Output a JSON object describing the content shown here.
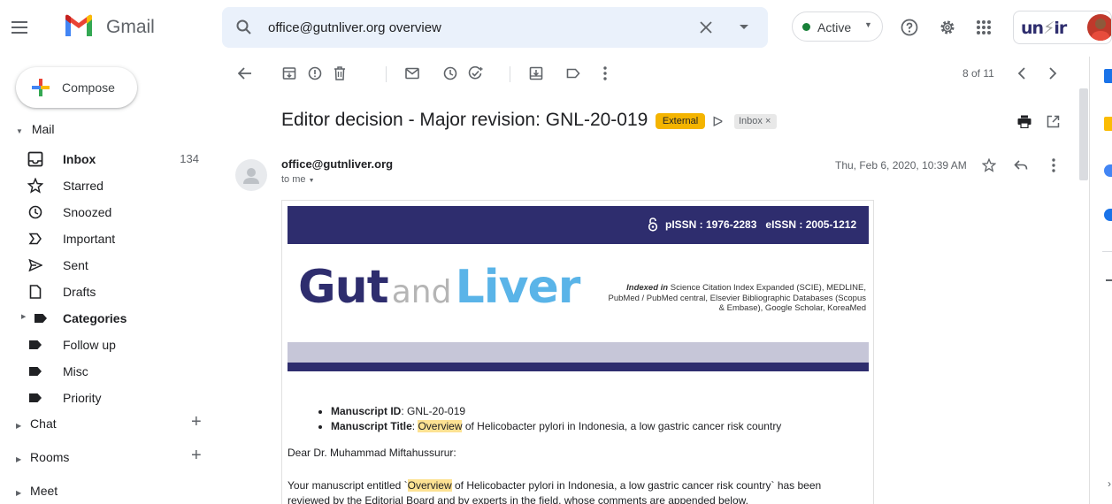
{
  "header": {
    "app_name": "Gmail",
    "search_value": "office@gutnliver.org overview",
    "status_label": "Active",
    "account_badge": "un⁧air"
  },
  "sidebar": {
    "compose_label": "Compose",
    "mail_section": "Mail",
    "items": [
      {
        "label": "Inbox",
        "count": "134",
        "icon": "inbox-icon",
        "bold": true
      },
      {
        "label": "Starred",
        "count": "",
        "icon": "star-icon"
      },
      {
        "label": "Snoozed",
        "count": "",
        "icon": "clock-icon"
      },
      {
        "label": "Important",
        "count": "",
        "icon": "important-icon"
      },
      {
        "label": "Sent",
        "count": "",
        "icon": "send-icon"
      },
      {
        "label": "Drafts",
        "count": "",
        "icon": "draft-icon"
      },
      {
        "label": "Categories",
        "count": "",
        "icon": "label-icon",
        "bold": true
      },
      {
        "label": "Follow up",
        "count": "",
        "icon": "label-icon"
      },
      {
        "label": "Misc",
        "count": "",
        "icon": "label-icon"
      },
      {
        "label": "Priority",
        "count": "",
        "icon": "label-icon"
      }
    ],
    "chat_section": "Chat",
    "rooms_section": "Rooms",
    "meet_section": "Meet"
  },
  "toolbar": {
    "pagination": "8 of 11"
  },
  "email": {
    "subject": "Editor decision - Major revision: GNL-20-019",
    "external_chip": "External",
    "inbox_chip": "Inbox",
    "sender": "office@gutnliver.org",
    "to": "to me",
    "date": "Thu, Feb 6, 2020, 10:39 AM",
    "body": {
      "issn": "pISSN : 1976-2283   eISSN : 2005-1212",
      "logo_gut": "Gut",
      "logo_and": "and",
      "logo_liver": "Liver",
      "indexed_label": "Indexed in",
      "indexed_text": "Science Citation Index Expanded (SCIE), MEDLINE, PubMed / PubMed central, Elsevier Bibliographic Databases (Scopus & Embase), Google Scholar, KoreaMed",
      "manuscript_id_label": "Manuscript ID",
      "manuscript_id": ": GNL-20-019",
      "manuscript_title_label": "Manuscript Title",
      "title_highlight": "Overview",
      "manuscript_title_rest": " of Helicobacter pylori in Indonesia, a low gastric cancer risk country",
      "greeting": "Dear Dr. Muhammad Miftahussurur:",
      "para_pre": "Your manuscript entitled `",
      "para_highlight": "Overview",
      "para_line1": " of Helicobacter pylori in Indonesia, a low gastric cancer risk country` has been",
      "para_line2": "reviewed by the Editorial Board and by experts in the field, whose comments are appended below."
    }
  },
  "colors": {
    "accent_blue": "#1a73e8",
    "journal_navy": "#2e2d6e",
    "logo_sky": "#5ab4e8",
    "external_chip": "#f4b400",
    "active_green": "#188038"
  }
}
